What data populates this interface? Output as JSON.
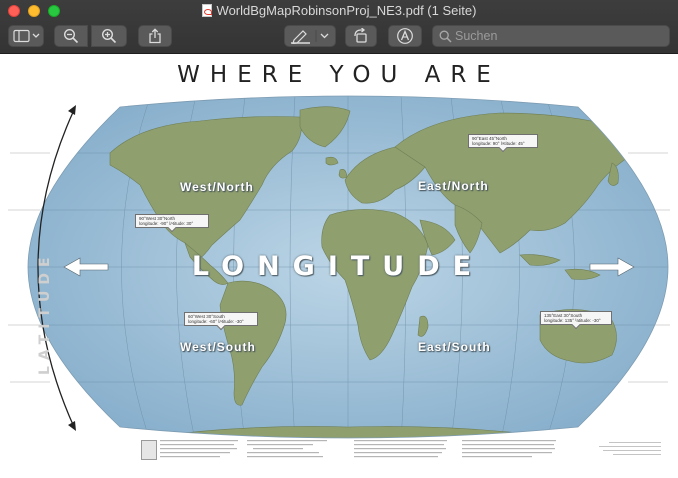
{
  "window": {
    "title": "WorldBgMapRobinsonProj_NE3.pdf (1 Seite)"
  },
  "toolbar": {
    "search_placeholder": "Suchen"
  },
  "document": {
    "heading": "WHERE YOU ARE",
    "latitude_label": "LATITUDE",
    "longitude_label": "LONGITUDE",
    "quadrants": {
      "west_north": "West/North",
      "east_north": "East/North",
      "west_south": "West/South",
      "east_south": "East/South"
    },
    "callouts": {
      "east_north": {
        "line1": "90°East 45°North",
        "line2": "longitude: 90° latitude: 45°"
      },
      "west_north": {
        "line1": "90°West 30°North",
        "line2": "longitude: -90° latitude: 30°"
      },
      "west_south": {
        "line1": "60°West 30°South",
        "line2": "longitude: -60° latitude: -30°"
      },
      "east_south": {
        "line1": "135°East 30°South",
        "line2": "longitude: 135° latitude: -30°"
      }
    }
  },
  "colors": {
    "ocean": "#a9c8dd",
    "land": "#8f9f6e",
    "titlebar": "#393939",
    "close": "#fe5f57",
    "minimize": "#febc2e",
    "maximize": "#28c840"
  }
}
